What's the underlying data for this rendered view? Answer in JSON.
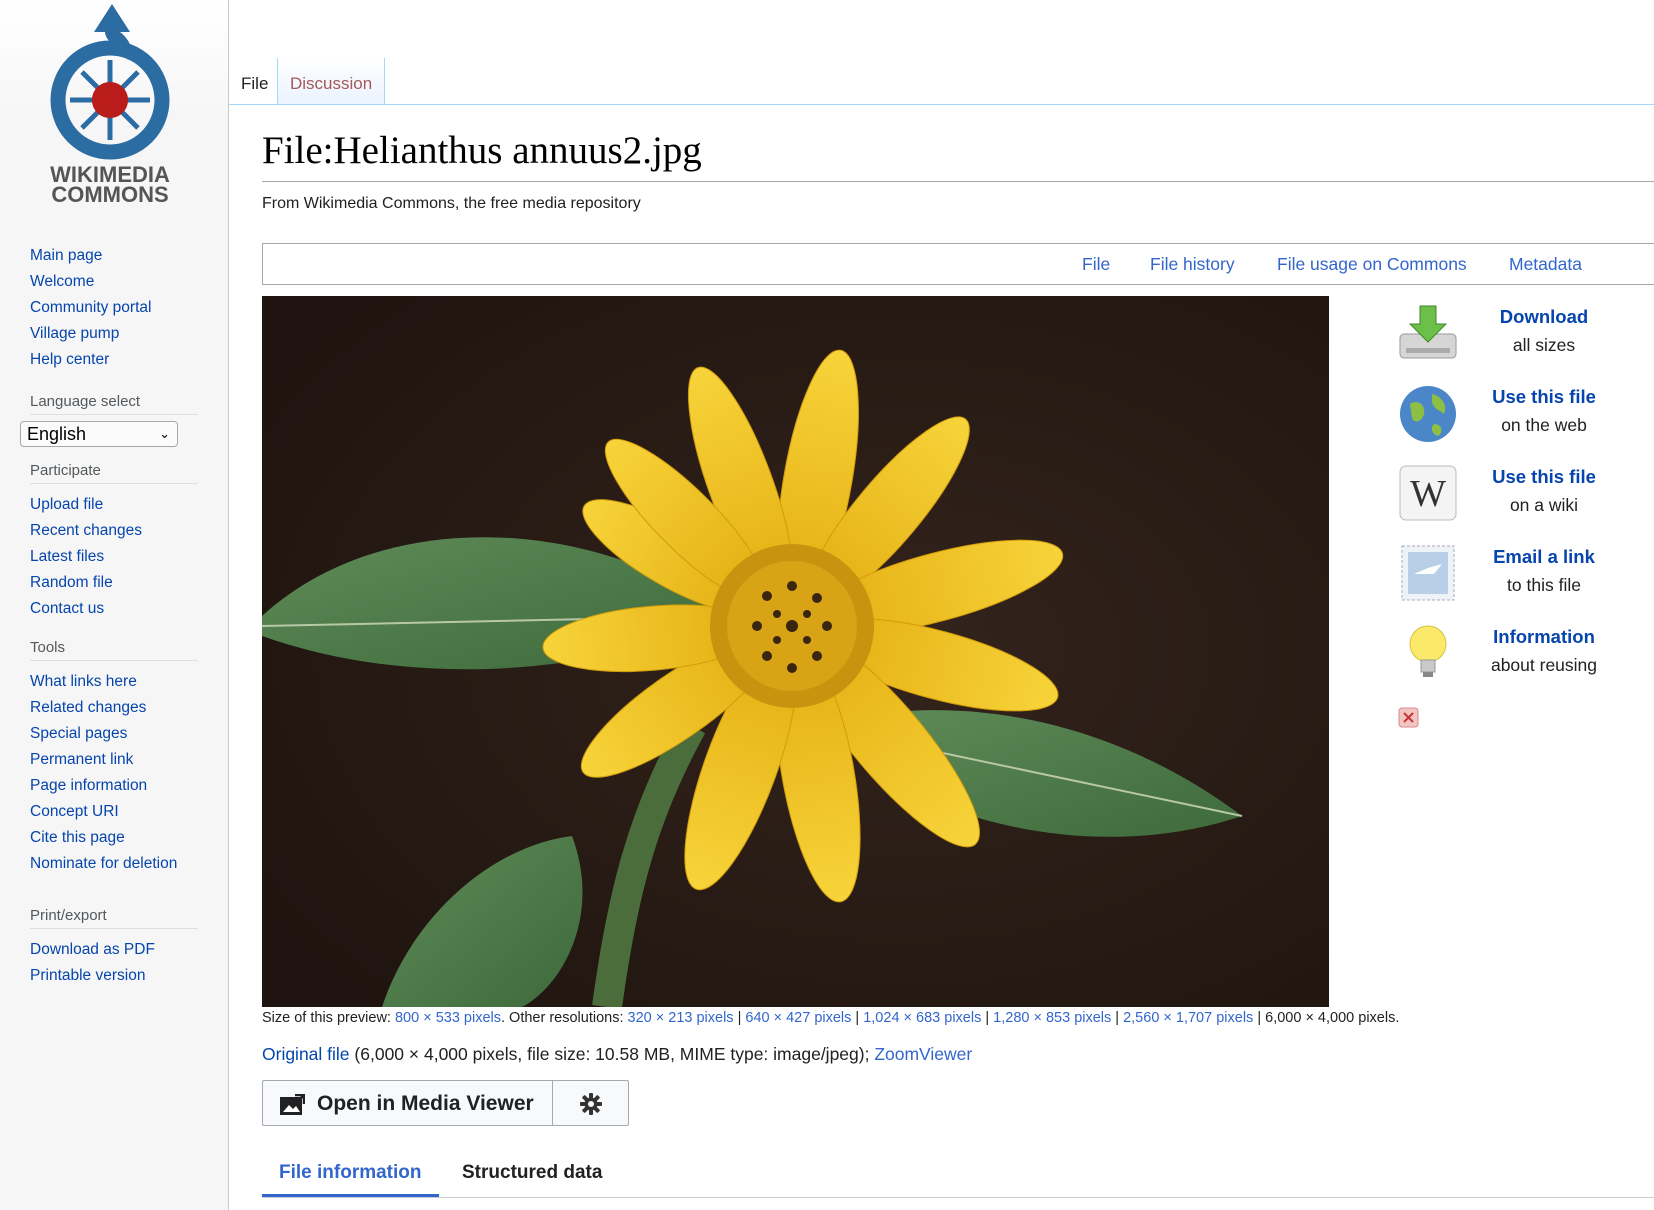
{
  "logo": {
    "line1": "WIKIMEDIA",
    "line2": "COMMONS"
  },
  "sidebar": {
    "navigation": [
      "Main page",
      "Welcome",
      "Community portal",
      "Village pump",
      "Help center"
    ],
    "language": {
      "heading": "Language select",
      "selected": "English"
    },
    "participate": {
      "heading": "Participate",
      "items": [
        "Upload file",
        "Recent changes",
        "Latest files",
        "Random file",
        "Contact us"
      ]
    },
    "tools": {
      "heading": "Tools",
      "items": [
        "What links here",
        "Related changes",
        "Special pages",
        "Permanent link",
        "Page information",
        "Concept URI",
        "Cite this page",
        "Nominate for deletion"
      ]
    },
    "print": {
      "heading": "Print/export",
      "items": [
        "Download as PDF",
        "Printable version"
      ]
    }
  },
  "tabs": {
    "file": "File",
    "discussion": "Discussion"
  },
  "page": {
    "title": "File:Helianthus annuus2.jpg",
    "tagline": "From Wikimedia Commons, the free media repository"
  },
  "file_toc": [
    "File",
    "File history",
    "File usage on Commons",
    "Metadata"
  ],
  "stock_tools": [
    {
      "title": "Download",
      "sub": "all sizes",
      "icon": "download-icon"
    },
    {
      "title": "Use this file",
      "sub": "on the web",
      "icon": "globe-icon"
    },
    {
      "title": "Use this file",
      "sub": "on a wiki",
      "icon": "wikipedia-icon"
    },
    {
      "title": "Email a link",
      "sub": "to this file",
      "icon": "email-stamp-icon"
    },
    {
      "title": "Information",
      "sub": "about reusing",
      "icon": "lightbulb-icon"
    }
  ],
  "preview": {
    "prefix": "Size of this preview: ",
    "preview_size": "800 × 533 pixels",
    "other": ". Other resolutions: ",
    "resolutions": [
      "320 × 213 pixels",
      "640 × 427 pixels",
      "1,024 × 683 pixels",
      "1,280 × 853 pixels",
      "2,560 × 1,707 pixels"
    ],
    "full": "6,000 × 4,000 pixels."
  },
  "original": {
    "link": "Original file",
    "details": " (6,000 × 4,000 pixels, file size: 10.58 MB, MIME type: image/jpeg); ",
    "zoom": "ZoomViewer"
  },
  "media_viewer": {
    "label": "Open in Media Viewer"
  },
  "info_tabs": {
    "file_information": "File information",
    "structured_data": "Structured data"
  },
  "colors": {
    "link": "#3366cc",
    "visited_link": "#0645ad",
    "petal": "#f2c418",
    "leaf": "#4f7c4c",
    "background": "#261a14"
  }
}
